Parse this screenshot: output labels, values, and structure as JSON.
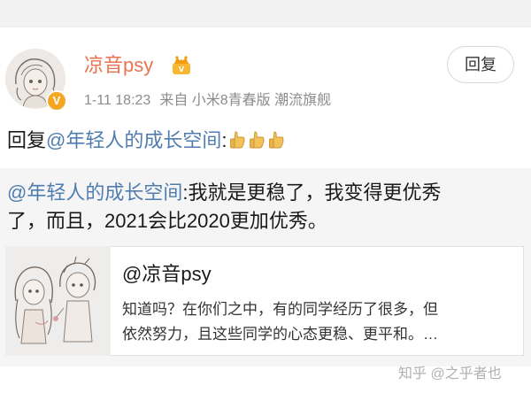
{
  "post": {
    "username": "凉音psy",
    "time": "1-11 18:23",
    "source": "来自 小米8青春版 潮流旗舰",
    "reply_button": "回复",
    "reply_prefix": "回复",
    "mention": "@年轻人的成长空间",
    "colon": ":",
    "icons": {
      "avatar": "avatar-sketch-image",
      "verified_badge": "verified-v-icon",
      "vip": "crown-vip-icon",
      "emoji": "thumbs-up-emoji"
    },
    "colors": {
      "username": "#eb7350",
      "mention": "#507daf",
      "badge": "#f5a623"
    }
  },
  "quote": {
    "mention": "@年轻人的成长空间",
    "line1_text": ":我就是更稳了，我变得更优秀",
    "line2": "了，而且，2021会比2020更加优秀。"
  },
  "card": {
    "title": "@凉音psy",
    "desc_line1": "知道吗？在你们之中，有的同学经历了很多，但",
    "desc_line2": "依然努力，且这些同学的心态更稳、更平和。…"
  },
  "watermark": "知乎 @之乎者也"
}
